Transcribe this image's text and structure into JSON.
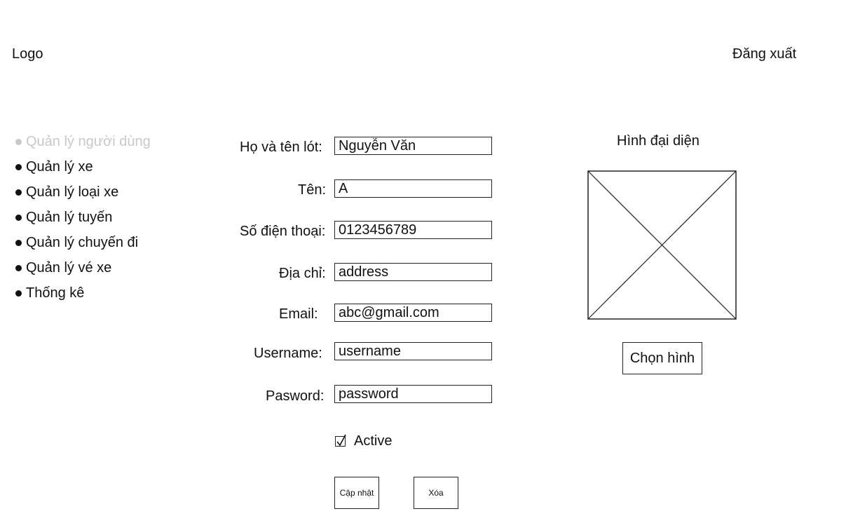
{
  "header": {
    "logo": "Logo",
    "logout": "Đăng xuất"
  },
  "sidebar": {
    "items": [
      {
        "label": "Quản lý người dùng"
      },
      {
        "label": "Quản lý xe"
      },
      {
        "label": "Quản lý loại xe"
      },
      {
        "label": "Quản lý tuyến"
      },
      {
        "label": "Quản lý chuyến đi"
      },
      {
        "label": "Quản lý vé xe"
      },
      {
        "label": "Thống kê"
      }
    ]
  },
  "form": {
    "fullname_label": "Họ và tên lót:",
    "fullname_value": "Nguyễn Văn",
    "name_label": "Tên:",
    "name_value": "A",
    "phone_label": "Số điện thoại:",
    "phone_value": "0123456789",
    "address_label": "Địa chỉ:",
    "address_value": "address",
    "email_label": "Email:",
    "email_value": "abc@gmail.com",
    "username_label": "Username:",
    "username_value": "username",
    "password_label": "Pasword:",
    "password_value": "password",
    "active_label": "Active",
    "update_label": "Cập nhật",
    "delete_label": "Xóa"
  },
  "avatar": {
    "title": "Hình đại diện",
    "choose_label": "Chọn hình"
  }
}
